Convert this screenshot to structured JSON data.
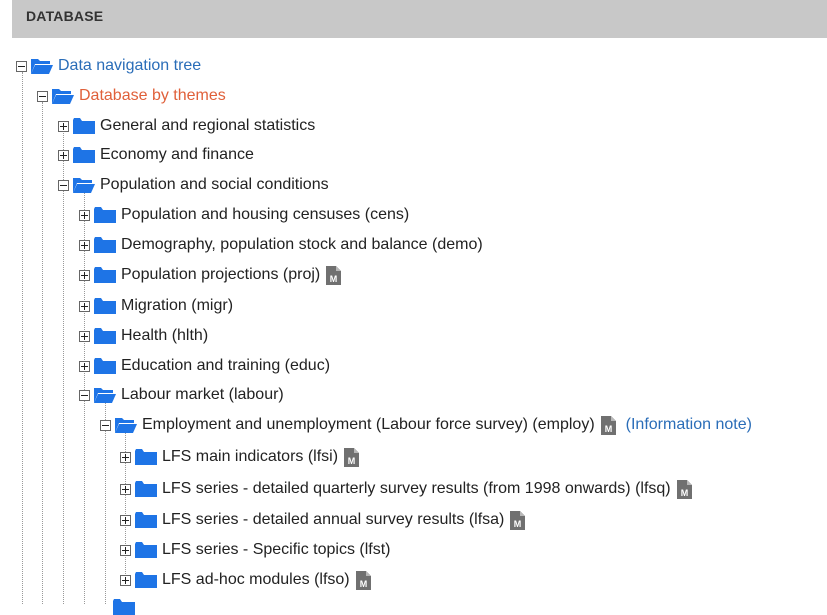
{
  "panel": {
    "title": "DATABASE"
  },
  "tree": {
    "root": "Data navigation tree",
    "themes": "Database by themes",
    "general": "General and regional statistics",
    "economy": "Economy and finance",
    "population_social": "Population and social conditions",
    "cens": "Population and housing censuses (cens)",
    "demo": "Demography, population stock and balance (demo)",
    "proj": "Population projections (proj)",
    "migr": "Migration (migr)",
    "hlth": "Health (hlth)",
    "educ": "Education and training (educ)",
    "labour": "Labour market (labour)",
    "employ": "Employment and unemployment (Labour force survey) (employ)",
    "information_note": "(Information note)",
    "lfsi": "LFS main indicators (lfsi)",
    "lfsq": "LFS series - detailed quarterly survey results (from 1998 onwards) (lfsq)",
    "lfsa": "LFS series - detailed annual survey results (lfsa)",
    "lfst": "LFS series - Specific topics (lfst)",
    "lfso": "LFS ad-hoc modules (lfso)"
  },
  "colors": {
    "folder": "#1e74e6",
    "metadata_icon": "#707070",
    "header_bg": "#c8c8c8"
  }
}
